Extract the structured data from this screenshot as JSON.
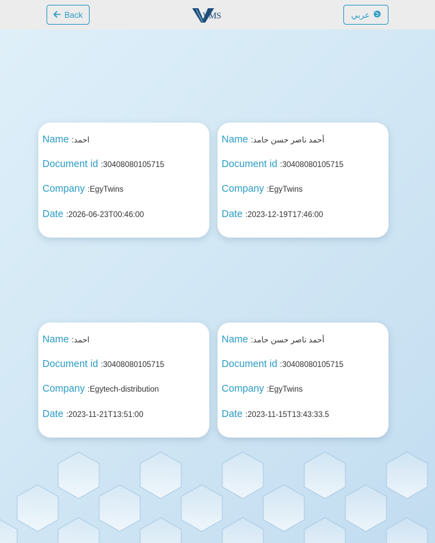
{
  "header": {
    "back_label": "Back",
    "language_label": "عربي",
    "logo_text": "VMS"
  },
  "labels": {
    "name": "Name",
    "document_id": "Document id",
    "company": "Company",
    "date": "Date"
  },
  "cards": [
    {
      "name": ":احمد",
      "document_id": ":30408080105715",
      "company": ":EgyTwins",
      "date": ":2026-06-23T00:46:00"
    },
    {
      "name": ":أحمد ناصر حسن حامد",
      "document_id": ":30408080105715",
      "company": ":EgyTwins",
      "date": ":2023-12-19T17:46:00"
    },
    {
      "name": ":احمد",
      "document_id": ":30408080105715",
      "company": ":Egytech-distribution",
      "date": ":2023-11-21T13:51:00"
    },
    {
      "name": ":أحمد ناصر حسن حامد",
      "document_id": ":30408080105715",
      "company": ":EgyTwins",
      "date": ":2023-11-15T13:43:33.5"
    }
  ],
  "colors": {
    "accent": "#2a9bc4",
    "topbar": "#ececec",
    "card": "#ffffff"
  },
  "icons": {
    "back": "arrow-left-icon",
    "language": "globe-icon"
  }
}
